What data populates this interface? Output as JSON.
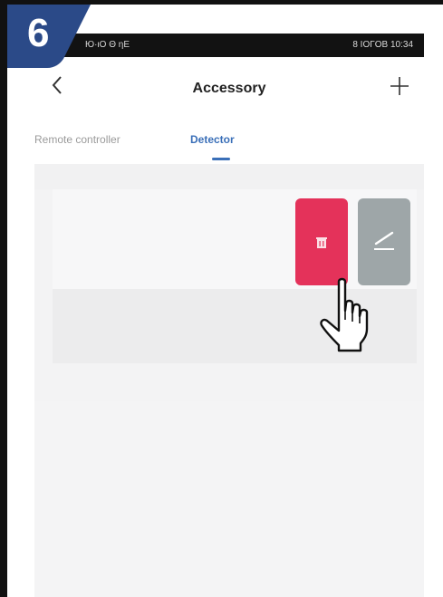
{
  "step": {
    "number": "6",
    "color": "#2b4a88"
  },
  "status_bar": {
    "left_text": "Ю·ιΟ Θ ηΕ",
    "right_text": "8 ΙΟΓΟΒ 10:34"
  },
  "nav": {
    "back_icon": "chevron-left-icon",
    "title": "Accessory",
    "add_icon": "plus-icon"
  },
  "tabs": [
    {
      "label": "Remote controller",
      "active": false
    },
    {
      "label": "Detector",
      "active": true
    }
  ],
  "swipe_actions": {
    "delete": {
      "icon": "trash-icon",
      "color": "#e4325a"
    },
    "edit": {
      "icon": "pencil-icon",
      "color": "#9ea6a8"
    }
  },
  "cursor": {
    "icon": "hand-pointer-icon"
  },
  "accent_color": "#3a6fb8"
}
